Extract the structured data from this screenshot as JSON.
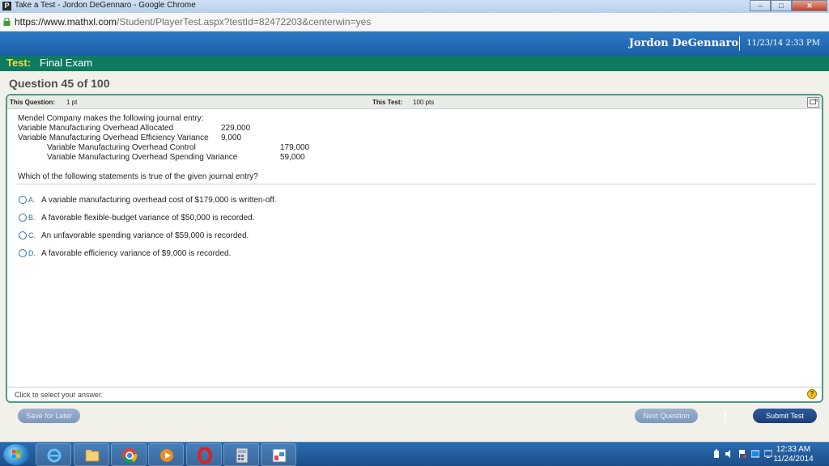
{
  "window": {
    "title": "Take a Test - Jordon DeGennaro - Google Chrome",
    "app_icon_letter": "P",
    "minimize": "–",
    "maximize": "□",
    "close": "✕"
  },
  "address": {
    "host": "https://www.mathxl.com",
    "path": "/Student/PlayerTest.aspx?testId=82472203&centerwin=yes"
  },
  "header": {
    "user": "Jordon DeGennaro",
    "datetime": "11/23/14 2:33 PM"
  },
  "test": {
    "label": "Test:",
    "name": "Final Exam"
  },
  "question": {
    "title": "Question 45 of 100",
    "this_question_label": "This Question:",
    "this_question_value": "1 pt",
    "this_test_label": "This Test:",
    "this_test_value": "100 pts",
    "intro": "Mendel Company makes the following journal entry:",
    "journal": [
      {
        "account": "Variable Manufacturing Overhead Allocated",
        "debit": "229,000",
        "credit": ""
      },
      {
        "account": "Variable Manufacturing Overhead Efficiency Variance",
        "debit": "9,000",
        "credit": ""
      },
      {
        "account": "Variable Manufacturing Overhead Control",
        "debit": "",
        "credit": "179,000"
      },
      {
        "account": "Variable Manufacturing Overhead Spending Variance",
        "debit": "",
        "credit": "59,000"
      }
    ],
    "prompt": "Which of the following statements is true of the given journal entry?",
    "options": [
      {
        "letter": "A.",
        "text": "A variable manufacturing overhead cost of $179,000 is written-off."
      },
      {
        "letter": "B.",
        "text": "A favorable flexible-budget variance of $50,000 is recorded."
      },
      {
        "letter": "C.",
        "text": "An unfavorable spending variance of $59,000 is recorded."
      },
      {
        "letter": "D.",
        "text": "A favorable efficiency variance of $9,000 is recorded."
      }
    ],
    "hint": "Click to select your answer.",
    "help": "?"
  },
  "buttons": {
    "save_later": "Save for Later",
    "next_question": "Next Question",
    "submit_test": "Submit Test"
  },
  "taskbar": {
    "time": "12:33 AM",
    "date": "11/24/2014",
    "apps": [
      "windows-explorer-icon",
      "internet-explorer-icon",
      "file-explorer-icon",
      "chrome-icon",
      "media-player-icon",
      "opera-icon",
      "calculator-icon",
      "paint-icon"
    ]
  },
  "colors": {
    "header_blue": "#1a5fa8",
    "test_green": "#0f7a62",
    "test_label_yellow": "#f0df3a",
    "panel_border": "#4d9a86",
    "submit_blue": "#1b3f78"
  }
}
